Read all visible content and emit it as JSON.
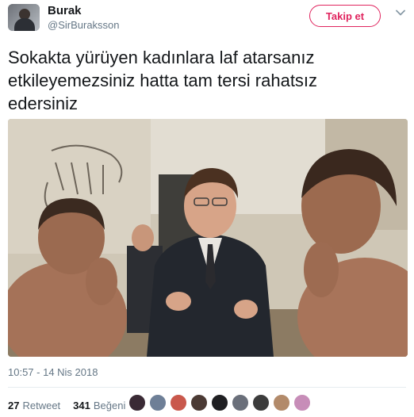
{
  "author": {
    "name": "Burak",
    "handle": "@SirBuraksson"
  },
  "follow_button": {
    "label": "Takip et",
    "color": "#e0245e"
  },
  "tweet": {
    "lines": [
      "Sokakta yürüyen kadınlara laf atarsanız",
      "etkileyemezsiniz hatta tam tersi rahatsız",
      "edersiniz"
    ]
  },
  "photo": {
    "icon": "photo-caveman-statues-man-talking"
  },
  "timestamp": "10:57 - 14 Nis 2018",
  "stats": {
    "retweets": {
      "count": "27",
      "label": "Retweet"
    },
    "likes": {
      "count": "341",
      "label": "Beğeni"
    }
  },
  "likers": [
    {
      "color": "#3a2a35"
    },
    {
      "color": "#6e7f97"
    },
    {
      "color": "#c9584c"
    },
    {
      "color": "#4b3a34"
    },
    {
      "color": "#1f1f22"
    },
    {
      "color": "#6a6f7a"
    },
    {
      "color": "#3c3c3c"
    },
    {
      "color": "#b28a6a"
    },
    {
      "color": "#c78db8"
    }
  ],
  "colors": {
    "text_primary": "#14171a",
    "text_secondary": "#657786",
    "divider": "#e6ecf0"
  }
}
